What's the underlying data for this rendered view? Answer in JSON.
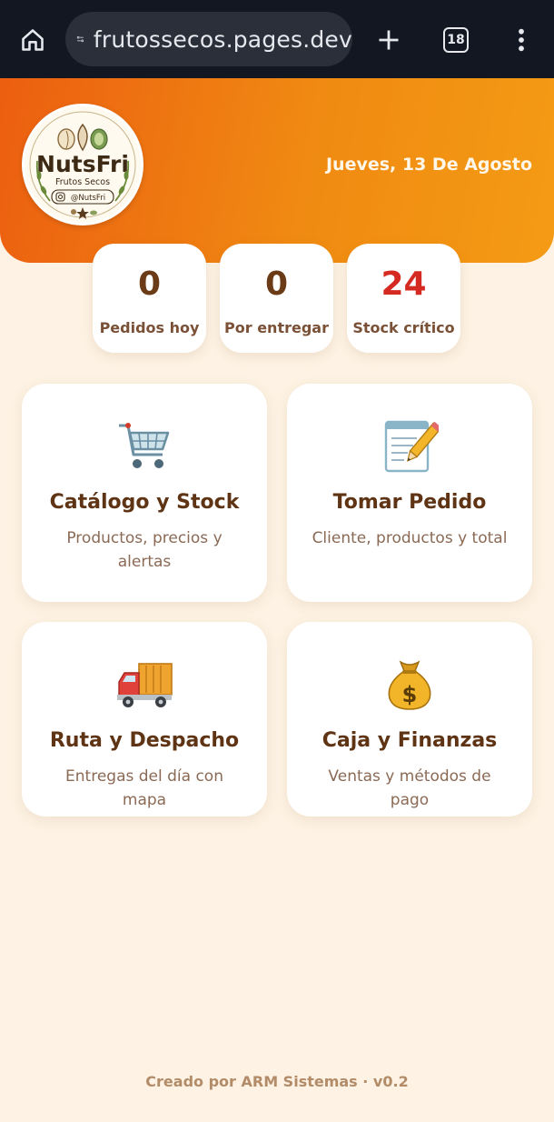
{
  "browser": {
    "url": "frutossecos.pages.dev",
    "tab_count": "18",
    "icons": [
      "home-icon",
      "site-settings-icon",
      "plus-icon",
      "tabs-icon",
      "more-vert-icon"
    ]
  },
  "header": {
    "date": "Jueves, 13 De Agosto",
    "logo": {
      "brand": "NutsFri",
      "tagline": "Frutos Secos",
      "handle": "@NutsFri"
    }
  },
  "stats": [
    {
      "value": "0",
      "label": "Pedidos hoy"
    },
    {
      "value": "0",
      "label": "Por entregar"
    },
    {
      "value": "24",
      "label": "Stock crítico"
    }
  ],
  "modules": [
    {
      "icon": "shopping-cart-icon",
      "title": "Catálogo y Stock",
      "subtitle": "Productos, precios y alertas"
    },
    {
      "icon": "memo-icon",
      "title": "Tomar Pedido",
      "subtitle": "Cliente, productos y total"
    },
    {
      "icon": "delivery-truck-icon",
      "title": "Ruta y Despacho",
      "subtitle": "Entregas del día con mapa"
    },
    {
      "icon": "money-bag-icon",
      "title": "Caja y Finanzas",
      "subtitle": "Ventas y métodos de pago"
    }
  ],
  "footer": {
    "text": "Creado por ARM Sistemas · v0.2"
  },
  "colors": {
    "header_start": "#ec5e10",
    "header_end": "#f49b14",
    "background": "#fdf2e3",
    "critical": "#d42a22",
    "text_brown": "#5e3414"
  }
}
